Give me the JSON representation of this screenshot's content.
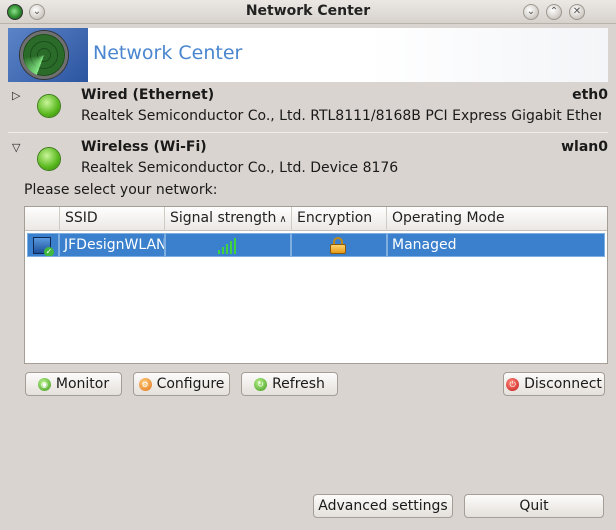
{
  "window": {
    "title": "Network Center",
    "app_icon": "radar-icon",
    "controls": [
      "shade-icon",
      "minimize-icon",
      "maximize-icon",
      "close-icon"
    ]
  },
  "banner": {
    "title": "Network Center"
  },
  "devices": [
    {
      "name": "Wired (Ethernet)",
      "interface": "eth0",
      "description": "Realtek Semiconductor Co., Ltd. RTL8111/8168B PCI Express Gigabit Ethern…",
      "expanded": false
    },
    {
      "name": "Wireless (Wi-Fi)",
      "interface": "wlan0",
      "description": "Realtek Semiconductor Co., Ltd. Device 8176",
      "expanded": true
    }
  ],
  "wireless": {
    "select_label": "Please select your network:",
    "columns": [
      "SSID",
      "Signal strength",
      "Encryption",
      "Operating Mode"
    ],
    "sorted_column": "Signal strength",
    "networks": [
      {
        "ssid": "JFDesignWLAN",
        "signal_bars": 5,
        "encryption_icon": "lock-icon",
        "mode": "Managed",
        "selected": true
      }
    ],
    "buttons": {
      "monitor": "Monitor",
      "configure": "Configure",
      "refresh": "Refresh",
      "disconnect": "Disconnect"
    }
  },
  "footer": {
    "advanced": "Advanced settings",
    "quit": "Quit"
  },
  "colors": {
    "accent": "#3a80cc",
    "banner_text": "#4a86cf",
    "signal": "#3fd43f"
  }
}
